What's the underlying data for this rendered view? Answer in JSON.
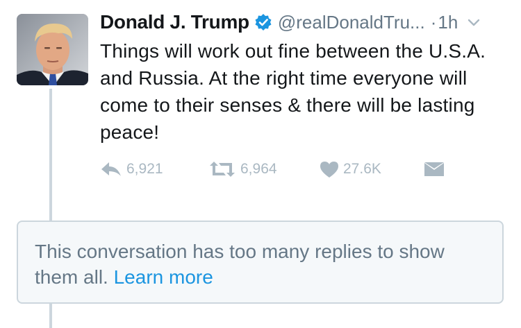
{
  "tweet": {
    "author_name": "Donald J. Trump",
    "handle": "@realDonaldTru...",
    "separator": "·",
    "timestamp": "1h",
    "text": "Things will work out fine between the U.S.A. and Russia. At the right time everyone will come to their senses & there will be lasting peace!",
    "avatar_icon": "avatar-photo"
  },
  "actions": {
    "reply_count": "6,921",
    "retweet_count": "6,964",
    "like_count": "27.6K"
  },
  "notice": {
    "message": "This conversation has too many replies to show them all.",
    "link_label": "Learn more"
  },
  "colors": {
    "accent": "#1b95e0",
    "muted": "#657786",
    "action_gray": "#aab8c2",
    "text": "#14171a"
  }
}
